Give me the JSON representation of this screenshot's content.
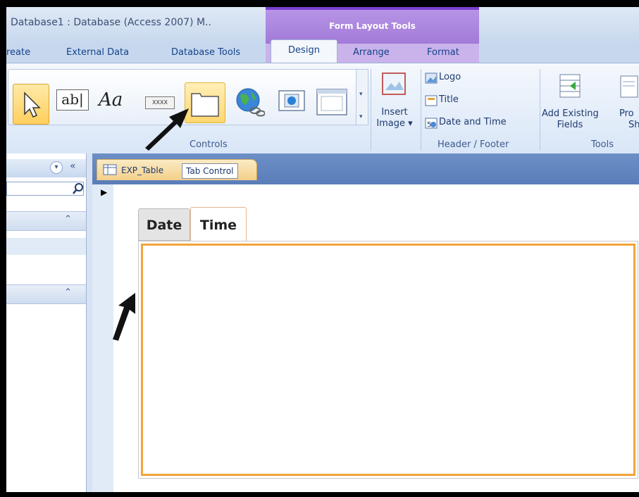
{
  "window": {
    "title": "Database1 : Database (Access 2007) M..",
    "contextual_tools_label": "Form Layout Tools"
  },
  "ribbon_tabs": [
    "reate",
    "External Data",
    "Database Tools",
    "Design",
    "Arrange",
    "Format"
  ],
  "ribbon": {
    "controls_group_label": "Controls",
    "controls": {
      "select": "select-pointer",
      "textbox_label": "ab|",
      "label_text": "Aa",
      "button_text": "XXXX",
      "tab_control": "tab-control",
      "hyperlink": "hyperlink",
      "image": "image",
      "subform": "subform"
    },
    "insert_image": {
      "label_line1": "Insert",
      "label_line2": "Image"
    },
    "header_footer": {
      "group_label": "Header / Footer",
      "items": [
        "Logo",
        "Title",
        "Date and Time"
      ]
    },
    "tools": {
      "group_label": "Tools",
      "add_existing_fields_line1": "Add Existing",
      "add_existing_fields_line2": "Fields",
      "property_sheet_line1": "Pro",
      "property_sheet_line2": "Sh"
    }
  },
  "document": {
    "tab_name": "EXP_Table",
    "tooltip": "Tab Control"
  },
  "form": {
    "tab_control": {
      "pages": [
        {
          "label": "Date",
          "selected": false
        },
        {
          "label": "Time",
          "selected": true
        }
      ]
    }
  },
  "colors": {
    "contextual_accent": "#a27ad8",
    "selection_orange": "#f3a43a",
    "ribbon_text": "#15428b"
  }
}
